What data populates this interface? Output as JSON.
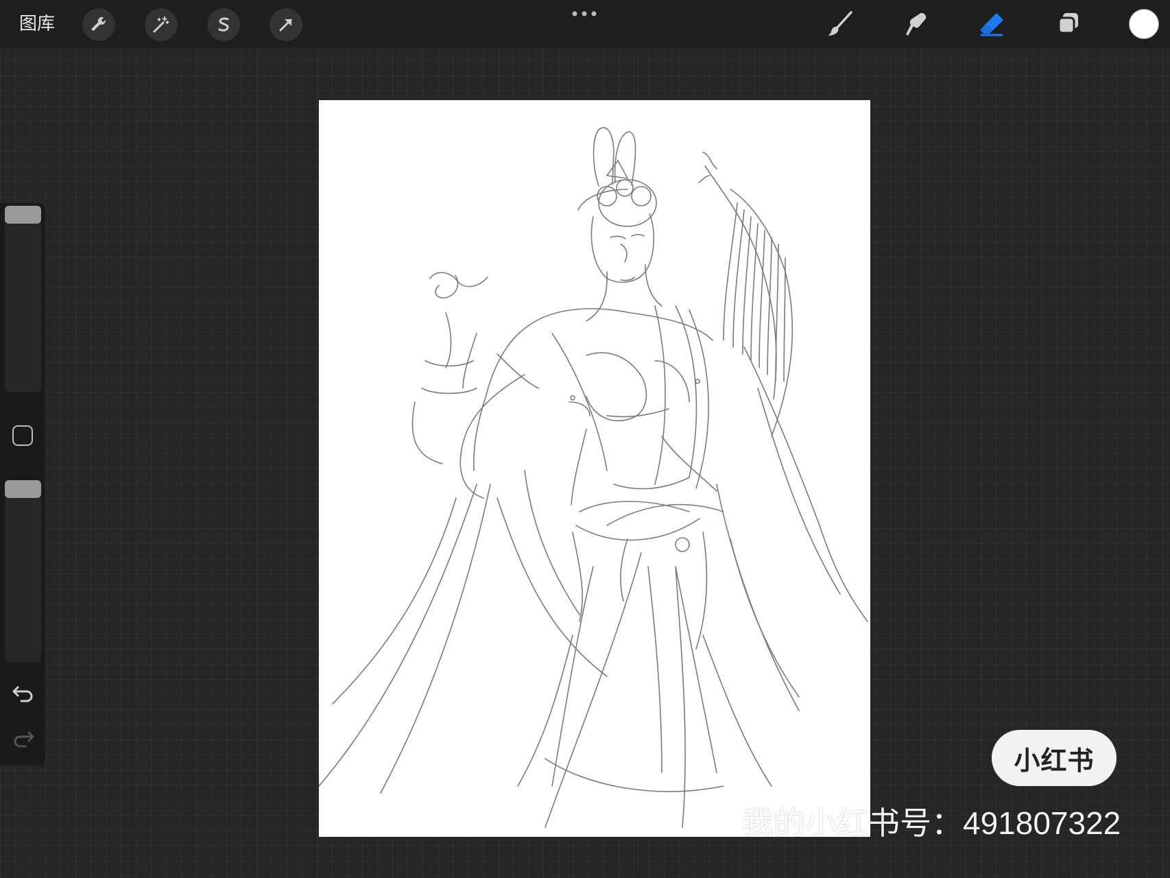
{
  "topbar": {
    "gallery_label": "图库",
    "tools_left": [
      "wrench-icon",
      "magic-wand-icon",
      "selection-s-icon",
      "arrow-transform-icon"
    ],
    "tools_right": [
      "brush-icon",
      "smudge-icon",
      "eraser-icon",
      "layers-icon"
    ],
    "active_tool": "eraser",
    "active_color": "#ffffff",
    "accent_color": "#1a7cf5"
  },
  "sidebar": {
    "brush_size_level": 0.97,
    "opacity_level": 0.97,
    "icons": [
      "modify-square-icon",
      "undo-icon",
      "redo-icon"
    ]
  },
  "canvas": {
    "content": "pencil sketch of a figure with a harp",
    "background": "#ffffff"
  },
  "overlay": {
    "badge_text": "小红书",
    "watermark_text": "我的小红书号：491807322"
  }
}
